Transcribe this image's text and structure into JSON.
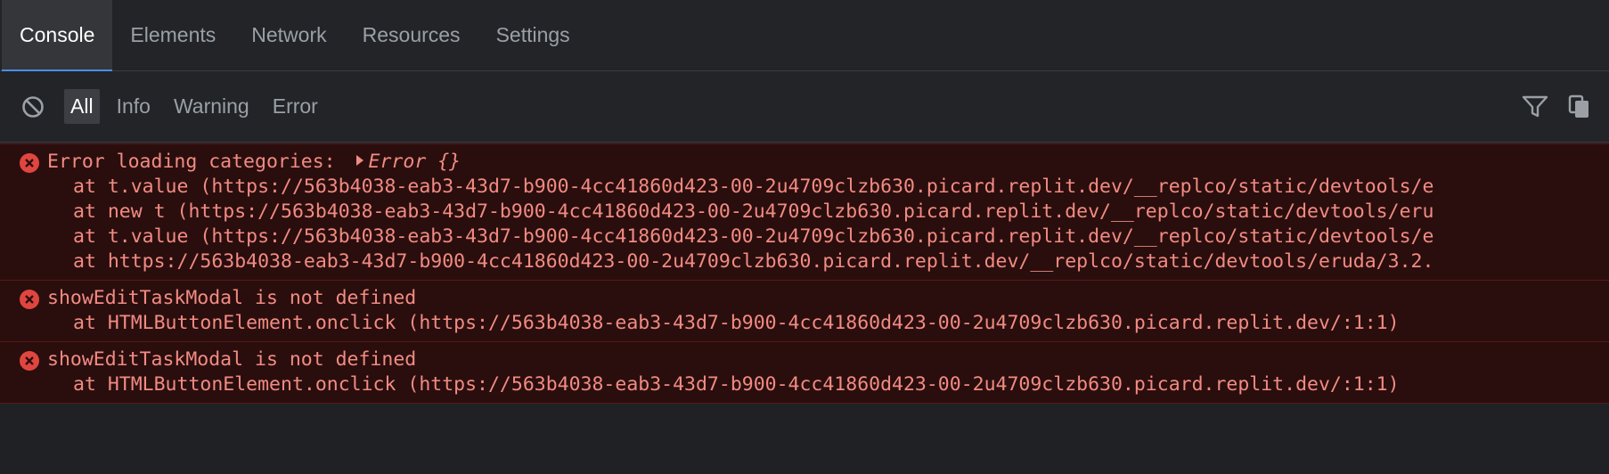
{
  "tabs": [
    {
      "label": "Console",
      "active": true
    },
    {
      "label": "Elements",
      "active": false
    },
    {
      "label": "Network",
      "active": false
    },
    {
      "label": "Resources",
      "active": false
    },
    {
      "label": "Settings",
      "active": false
    }
  ],
  "toolbar": {
    "clear_icon": "clear-console-icon",
    "filters": [
      {
        "label": "All",
        "active": true
      },
      {
        "label": "Info",
        "active": false
      },
      {
        "label": "Warning",
        "active": false
      },
      {
        "label": "Error",
        "active": false
      }
    ],
    "right_icons": [
      "filter-icon",
      "copy-icon"
    ]
  },
  "colors": {
    "accent": "#4a8fe7",
    "error_text": "#f28b82",
    "error_bg": "#2a0e0e",
    "error_icon": "#e0463f"
  },
  "entries": [
    {
      "type": "error",
      "message": "Error loading categories: ",
      "object": "Error {}",
      "stack": [
        "at t.value (https://563b4038-eab3-43d7-b900-4cc41860d423-00-2u4709clzb630.picard.replit.dev/__replco/static/devtools/e",
        "at new t (https://563b4038-eab3-43d7-b900-4cc41860d423-00-2u4709clzb630.picard.replit.dev/__replco/static/devtools/eru",
        "at t.value (https://563b4038-eab3-43d7-b900-4cc41860d423-00-2u4709clzb630.picard.replit.dev/__replco/static/devtools/e",
        "at https://563b4038-eab3-43d7-b900-4cc41860d423-00-2u4709clzb630.picard.replit.dev/__replco/static/devtools/eruda/3.2."
      ]
    },
    {
      "type": "error",
      "message": "showEditTaskModal is not defined",
      "stack": [
        "at HTMLButtonElement.onclick (https://563b4038-eab3-43d7-b900-4cc41860d423-00-2u4709clzb630.picard.replit.dev/:1:1)"
      ]
    },
    {
      "type": "error",
      "message": "showEditTaskModal is not defined",
      "stack": [
        "at HTMLButtonElement.onclick (https://563b4038-eab3-43d7-b900-4cc41860d423-00-2u4709clzb630.picard.replit.dev/:1:1)"
      ]
    }
  ]
}
